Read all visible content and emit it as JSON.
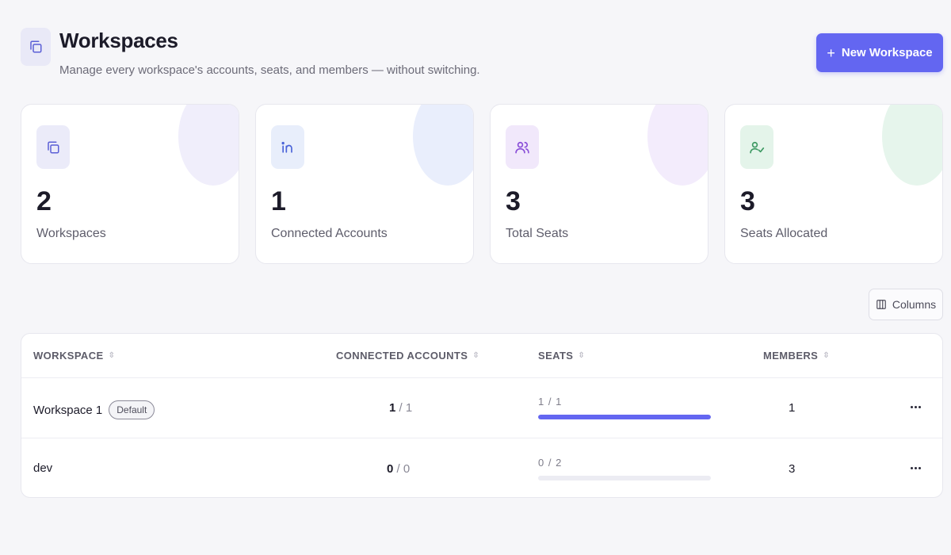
{
  "header": {
    "icon": "copy-icon",
    "title": "Workspaces",
    "subtitle": "Manage every workspace's accounts, seats, and members — without switching.",
    "new_button_label": "New Workspace",
    "new_button_icon": "plus-icon"
  },
  "stats": [
    {
      "icon": "copy-icon",
      "value": "2",
      "label": "Workspaces",
      "icon_bg": "#ebebf9",
      "icon_color": "#5b5fd6",
      "blob_color": "#f0eefb"
    },
    {
      "icon": "linkedin-icon",
      "value": "1",
      "label": "Connected Accounts",
      "icon_bg": "#e8eefb",
      "icon_color": "#4a63d8",
      "blob_color": "#e9eefc"
    },
    {
      "icon": "users-icon",
      "value": "3",
      "label": "Total Seats",
      "icon_bg": "#f1e8fb",
      "icon_color": "#8a4fd8",
      "blob_color": "#f3ecfc"
    },
    {
      "icon": "user-check-icon",
      "value": "3",
      "label": "Seats Allocated",
      "icon_bg": "#e4f4ea",
      "icon_color": "#3f9a64",
      "blob_color": "#e6f5ec"
    }
  ],
  "columns_button": {
    "label": "Columns",
    "icon": "columns-icon"
  },
  "table": {
    "headers": {
      "workspace": "WORKSPACE",
      "connected_accounts": "CONNECTED ACCOUNTS",
      "seats": "SEATS",
      "members": "MEMBERS"
    },
    "rows": [
      {
        "name": "Workspace 1",
        "badge": "Default",
        "acc_used": "1",
        "acc_total": "1",
        "seats_text": "1 / 1",
        "seats_fraction": 1.0,
        "members": "1"
      },
      {
        "name": "dev",
        "badge": "",
        "acc_used": "0",
        "acc_total": "0",
        "seats_text": "0 / 2",
        "seats_fraction": 0.0,
        "members": "3"
      }
    ]
  },
  "colors": {
    "accent": "#6366f1"
  }
}
